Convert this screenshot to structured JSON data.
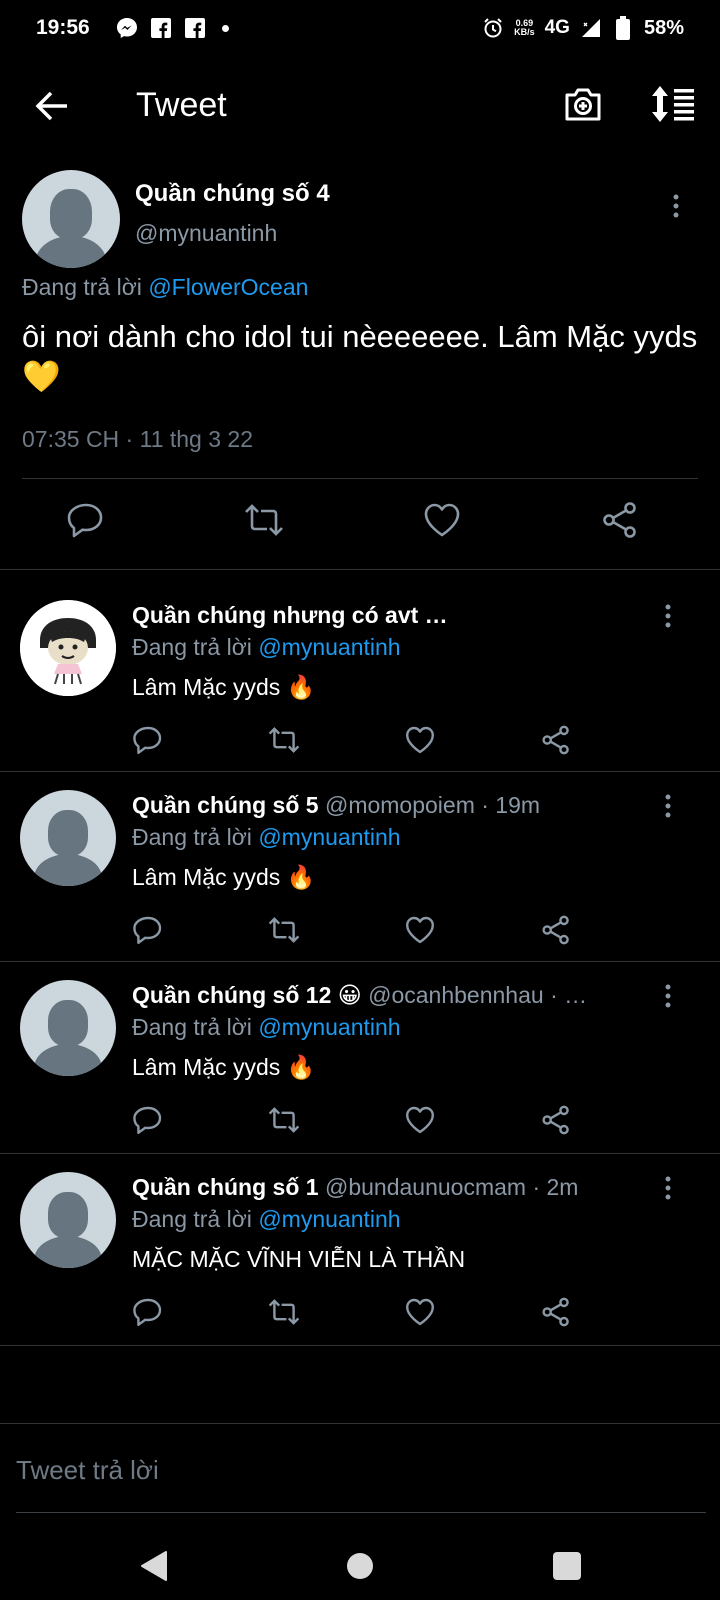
{
  "status_bar": {
    "time": "19:56",
    "speed_value": "0.69",
    "speed_unit": "KB/s",
    "network": "4G",
    "battery": "58%"
  },
  "header": {
    "title": "Tweet"
  },
  "main_tweet": {
    "name": "Quần chúng số 4",
    "handle": "@mynuantinh",
    "replying_prefix": "Đang trả lời ",
    "replying_to": "@FlowerOcean",
    "text": "ôi nơi dành cho idol tui nèeeeeee. Lâm Mặc yyds 💛",
    "timestamp": "07:35 CH · 11 thg 3 22"
  },
  "replies": [
    {
      "name": "Quần chúng nhưng có avt …",
      "handle": "",
      "replying_prefix": "Đang trả lời ",
      "replying_to": "@mynuantinh",
      "text": "Lâm Mặc yyds 🔥",
      "avatar": "cartoon-avatar"
    },
    {
      "name": "Quần chúng số 5",
      "handle": " @momopoiem · 19m",
      "replying_prefix": "Đang trả lời ",
      "replying_to": "@mynuantinh",
      "text": "Lâm Mặc yyds 🔥",
      "avatar": "default-avatar"
    },
    {
      "name": "Quần chúng số 12 😀",
      "handle": " @ocanhbennhau · …",
      "replying_prefix": "Đang trả lời ",
      "replying_to": "@mynuantinh",
      "text": "Lâm Mặc yyds 🔥",
      "avatar": "default-avatar"
    },
    {
      "name": "Quần chúng số 1",
      "handle": " @bundaunuocmam · 2m",
      "replying_prefix": "Đang trả lời ",
      "replying_to": "@mynuantinh",
      "text": "MẶC MẶC VĨNH VIỄN LÀ THẦN",
      "avatar": "default-avatar"
    }
  ],
  "composer": {
    "placeholder": "Tweet trả lời"
  },
  "colors": {
    "background": "#000000",
    "accent": "#1d9bf0",
    "secondary_text": "#8b98a5",
    "divider": "#2f3336"
  }
}
